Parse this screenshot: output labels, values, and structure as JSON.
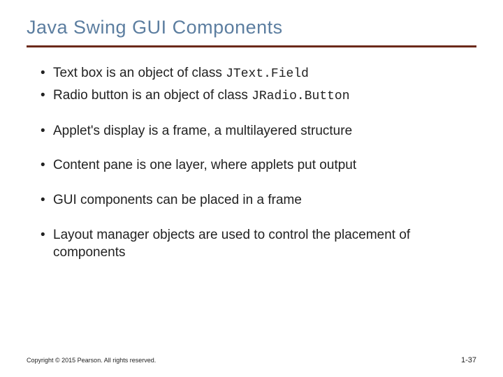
{
  "title": "Java Swing GUI Components",
  "bullets": {
    "b0_pre": "Text box is an object of class ",
    "b0_code": "JText.Field",
    "b1_pre": "Radio button is an object of class ",
    "b1_code": "JRadio.Button",
    "b2": "Applet's display is a frame, a multilayered structure",
    "b3": "Content pane is one layer, where applets put output",
    "b4": "GUI components can be placed in a frame",
    "b5": "Layout manager objects are used to control the placement of components"
  },
  "footer": {
    "copyright": "Copyright © 2015 Pearson. All rights reserved.",
    "page": "1-37"
  }
}
